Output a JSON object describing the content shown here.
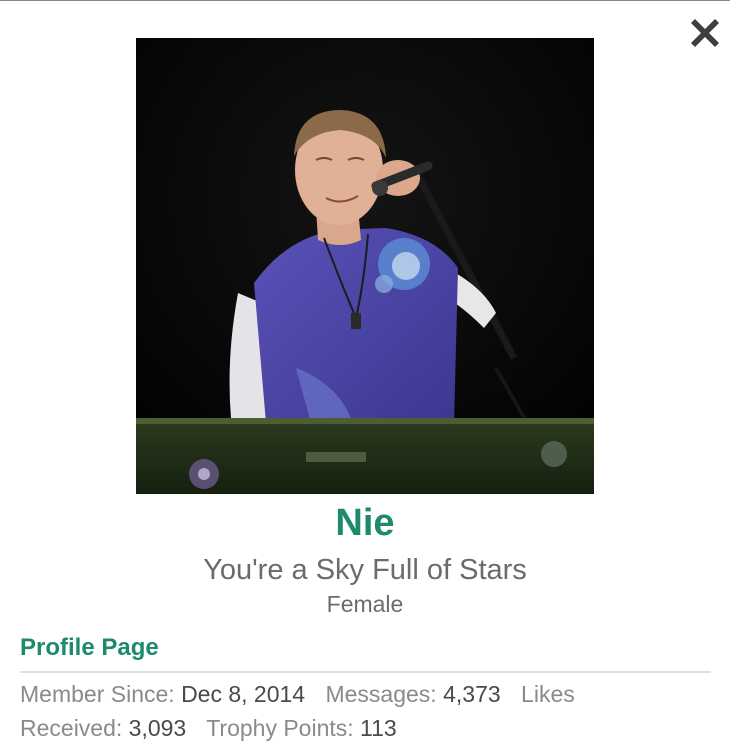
{
  "close_button": {
    "icon": "close-icon"
  },
  "profile": {
    "avatar_icon": "profile-photo",
    "username": "Nie",
    "title": "You're a Sky Full of Stars",
    "gender": "Female",
    "profile_link": "Profile Page"
  },
  "stats": {
    "member_since_label": "Member Since:",
    "member_since_value": "Dec 8, 2014",
    "messages_label": "Messages:",
    "messages_value": "4,373",
    "likes_label_line1": "Likes",
    "likes_label_line2": "Received:",
    "likes_value": "3,093",
    "trophy_label": "Trophy Points:",
    "trophy_value": "113"
  },
  "colors": {
    "accent": "#1d8a6b",
    "text_muted": "#6b6b6b",
    "divider": "#d5e3e2"
  }
}
